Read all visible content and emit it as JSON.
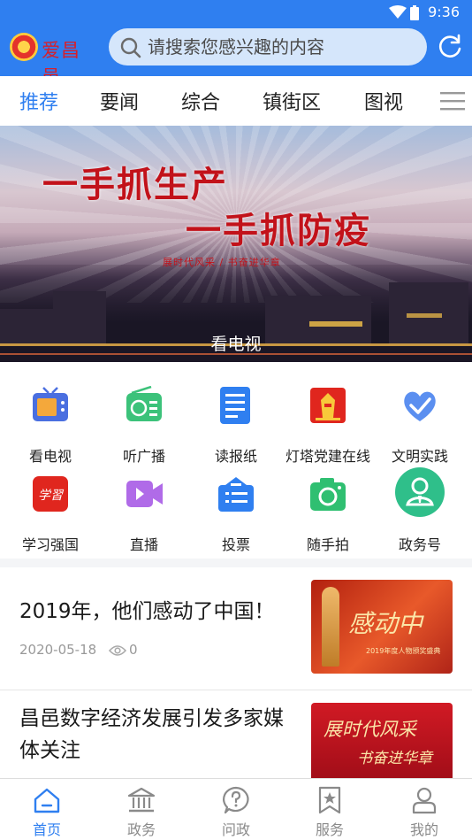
{
  "status_bar": {
    "time": "9:36"
  },
  "header": {
    "logo_text": "爱昌邑",
    "search_placeholder": "请搜索您感兴趣的内容"
  },
  "tabs": [
    {
      "label": "推荐",
      "active": true
    },
    {
      "label": "要闻",
      "active": false
    },
    {
      "label": "综合",
      "active": false
    },
    {
      "label": "镇街区",
      "active": false
    },
    {
      "label": "图视",
      "active": false
    }
  ],
  "banner": {
    "line1": "一手抓生产",
    "line2": "一手抓防疫",
    "subtitle": "展时代风采 / 书奋进华章",
    "caption": "看电视"
  },
  "services": [
    {
      "label": "看电视",
      "icon": "tv-icon",
      "color": "#4a6fe0"
    },
    {
      "label": "听广播",
      "icon": "radio-icon",
      "color": "#3cc27a"
    },
    {
      "label": "读报纸",
      "icon": "newspaper-icon",
      "color": "#2f7ff0"
    },
    {
      "label": "灯塔党建在线",
      "icon": "lighthouse-icon",
      "color": "#e0261e"
    },
    {
      "label": "文明实践",
      "icon": "heart-hand-icon",
      "color": "#4a86e8"
    },
    {
      "label": "学习强国",
      "icon": "xuexi-icon",
      "color": "#e0261e"
    },
    {
      "label": "直播",
      "icon": "video-camera-icon",
      "color": "#b06be8"
    },
    {
      "label": "投票",
      "icon": "ballot-box-icon",
      "color": "#2f7ff0"
    },
    {
      "label": "随手拍",
      "icon": "camera-icon",
      "color": "#2fbf71"
    },
    {
      "label": "政务号",
      "icon": "official-account-icon",
      "color": "#2fbf8a"
    }
  ],
  "news": [
    {
      "title": "2019年，他们感动了中国！",
      "date": "2020-05-18",
      "views": "0",
      "thumb_text": "感动中",
      "thumb_caption": "2019年度人物颁奖盛典"
    },
    {
      "title": "昌邑数字经济发展引发多家媒体关注",
      "thumb_text": "展时代风采",
      "thumb_text2": "书奋进华章"
    }
  ],
  "bottom_nav": [
    {
      "label": "首页",
      "icon": "home-icon",
      "active": true
    },
    {
      "label": "政务",
      "icon": "government-icon",
      "active": false
    },
    {
      "label": "问政",
      "icon": "question-icon",
      "active": false
    },
    {
      "label": "服务",
      "icon": "bookmark-star-icon",
      "active": false
    },
    {
      "label": "我的",
      "icon": "user-icon",
      "active": false
    }
  ],
  "colors": {
    "primary": "#2f7ff0",
    "accent_red": "#c2121a"
  }
}
